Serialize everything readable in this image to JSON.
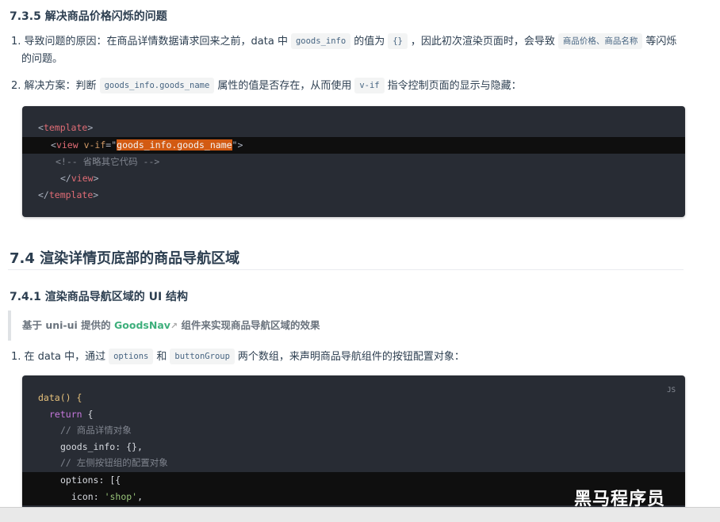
{
  "sec_735": {
    "title": "7.3.5 解决商品价格闪烁的问题"
  },
  "item1": {
    "num": "1.",
    "t1": "导致问题的原因：在商品详情数据请求回来之前，data 中",
    "c1": "goods_info",
    "t2": "的值为",
    "c2": "{}",
    "t3": "，因此初次渲染页面时，会导致",
    "c3": "商品价格、商品名称",
    "t4": "等闪烁",
    "t5": "的问题。"
  },
  "item2": {
    "num": "2.",
    "t1": "解决方案：判断",
    "c1": "goods_info.goods_name",
    "t2": "属性的值是否存在，从而使用",
    "c2": "v-if",
    "t3": "指令控制页面的显示与隐藏："
  },
  "code1": {
    "l1_tag": "template",
    "l2_tag": "view",
    "l2_attr": "v-if",
    "l2_val": "goods_info.goods_name",
    "l3_comment": "<!-- 省略其它代码 -->",
    "l4_tag": "view",
    "l5_tag": "template"
  },
  "sec_74": {
    "title": "7.4 渲染详情页底部的商品导航区域"
  },
  "sec_741": {
    "title": "7.4.1 渲染商品导航区域的 UI 结构"
  },
  "tip": {
    "t1": "基于 uni-ui 提供的",
    "link": "GoodsNav",
    "link_icon": "external-link-icon",
    "t2": "组件来实现商品导航区域的效果"
  },
  "item3": {
    "num": "1.",
    "t1": "在 data 中，通过",
    "c1": "options",
    "t2": "和",
    "c2": "buttonGroup",
    "t3": "两个数组，来声明商品导航组件的按钮配置对象："
  },
  "code2": {
    "lang": "JS",
    "l1": "data() {",
    "l2_kw": "return",
    "l2_rest": " {",
    "l3": "// 商品详情对象",
    "l4_key": "goods_info",
    "l4_rest": ": {},",
    "l5": "// 左侧按钮组的配置对象",
    "l6_key": "options",
    "l6_rest": ": [{",
    "l7_key": "icon",
    "l7_str": "'shop'",
    "l7_rest": ","
  },
  "watermark": {
    "text": "黑马程序员"
  },
  "colors": {
    "link": "#3eaf7c",
    "selection": "#d25a12",
    "code_bg": "#282c34"
  }
}
